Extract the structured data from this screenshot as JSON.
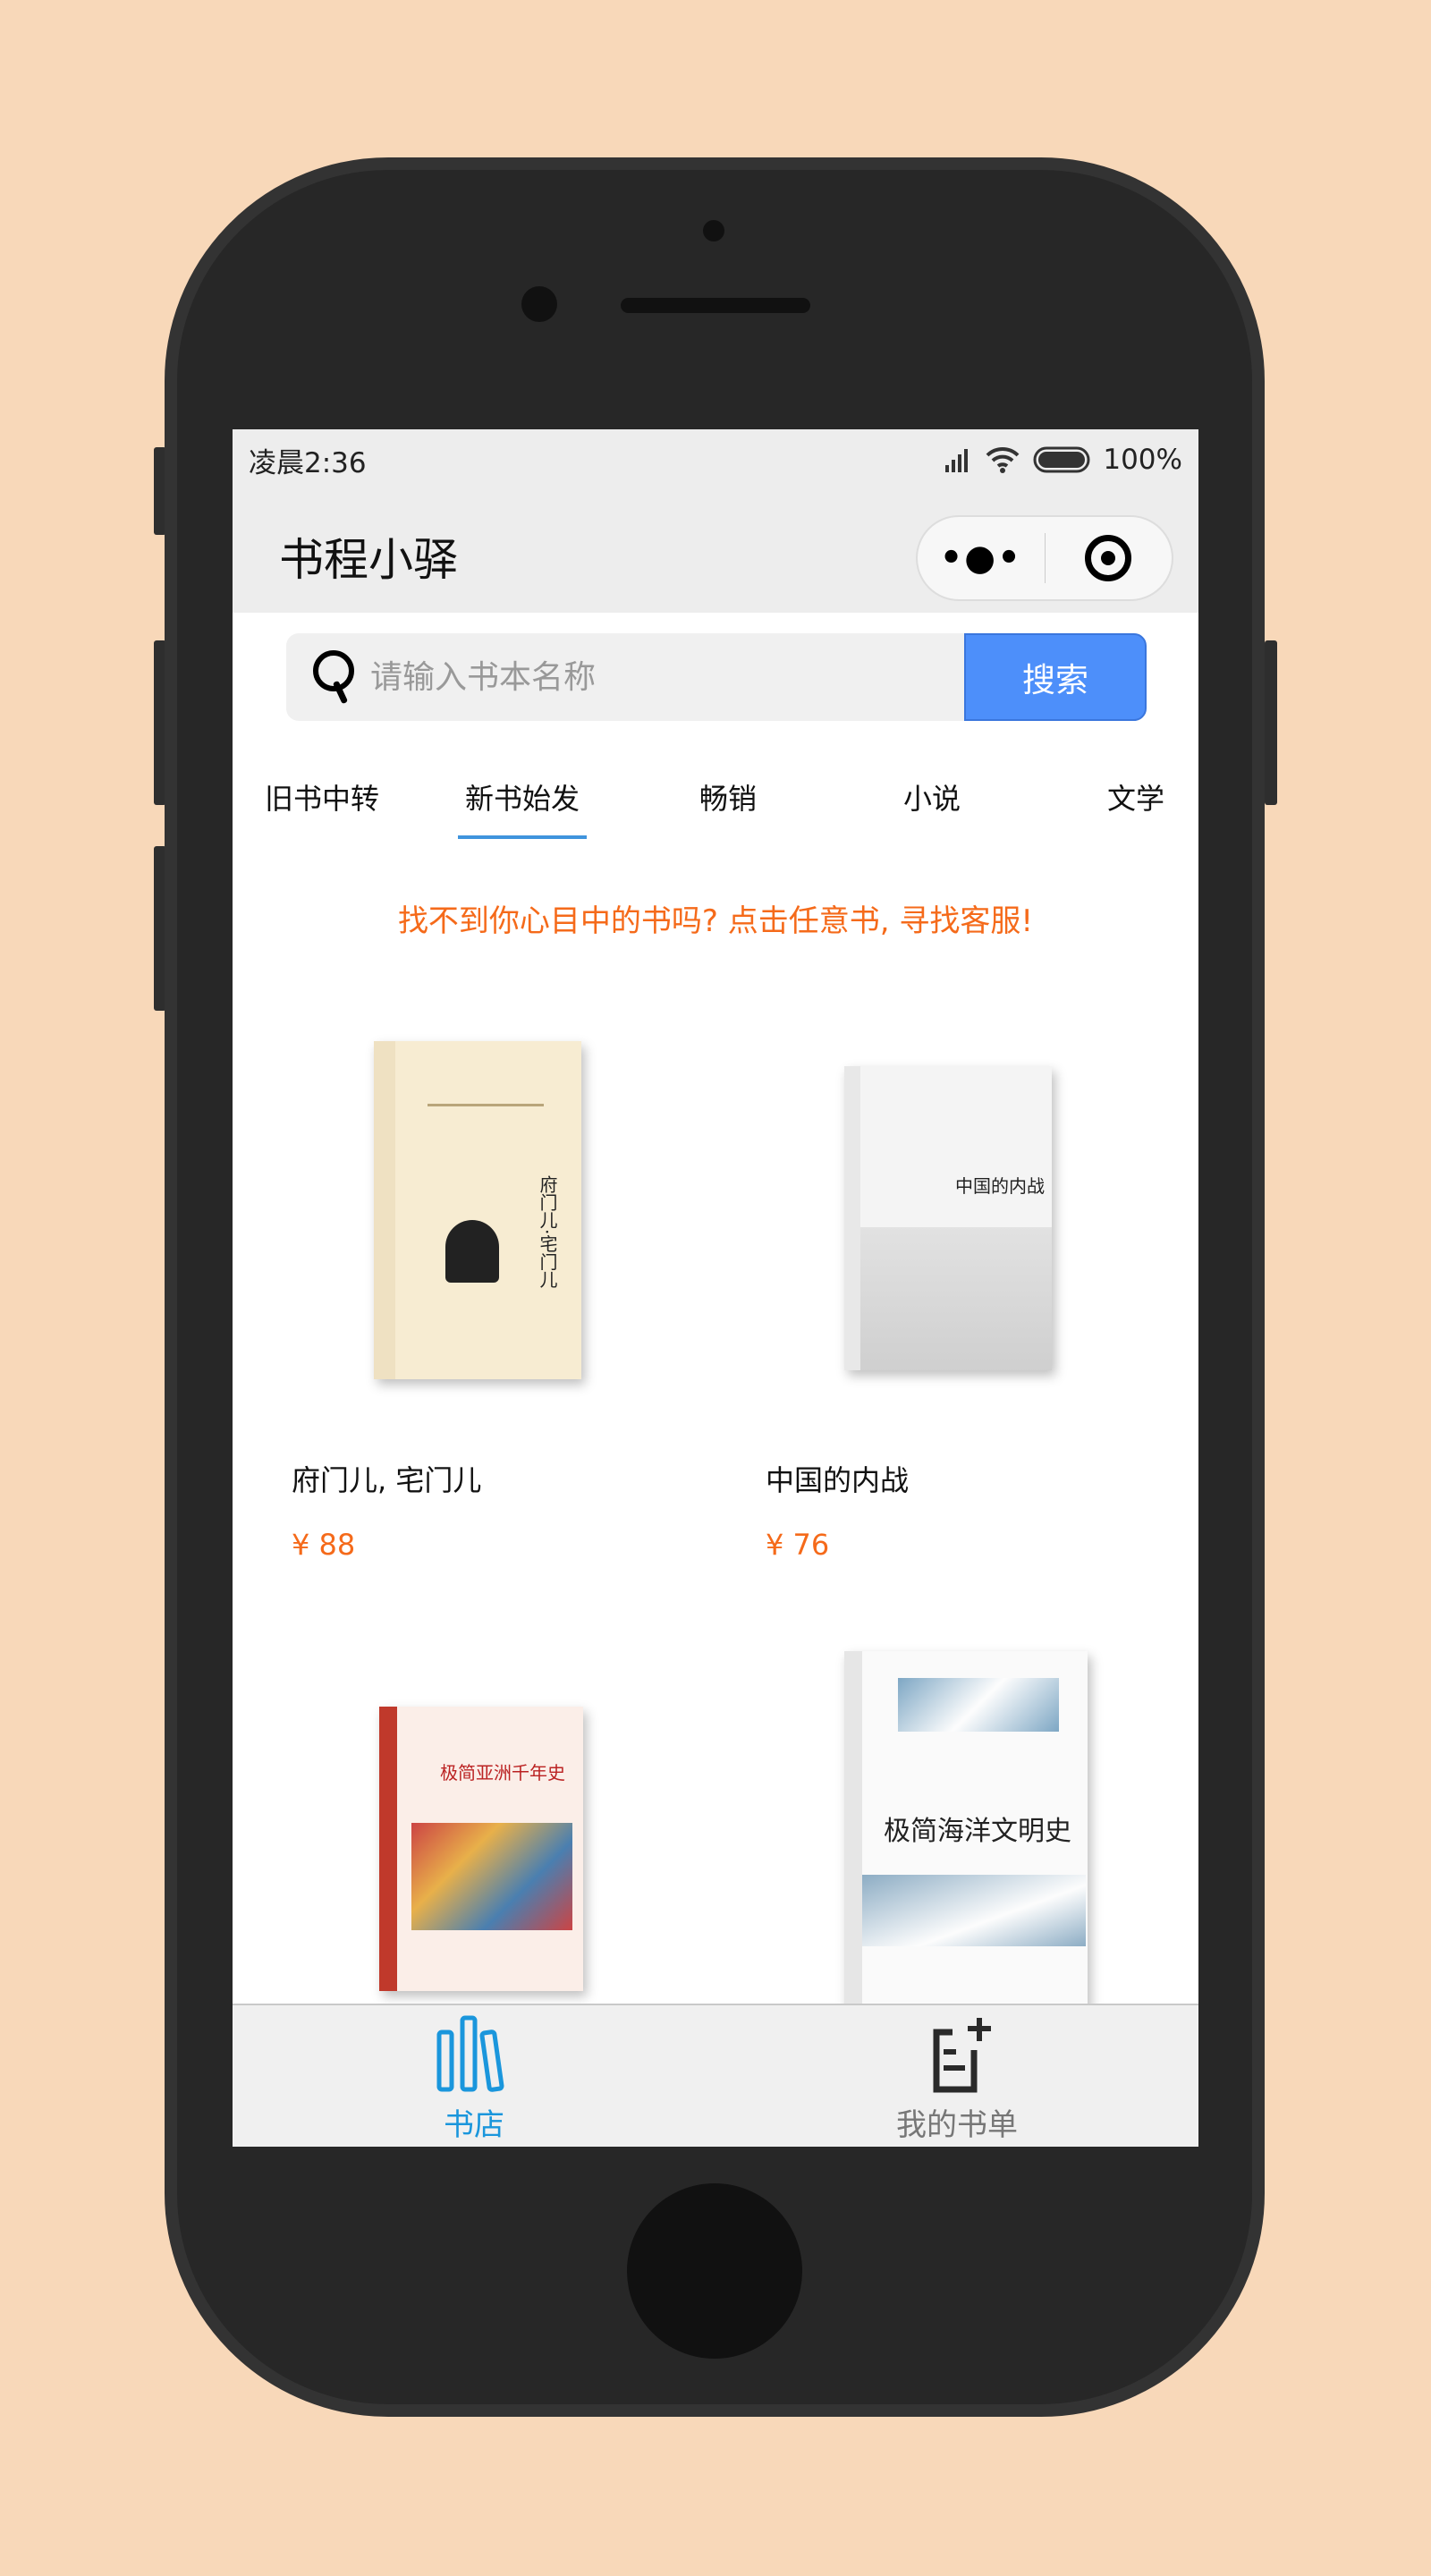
{
  "status_bar": {
    "time": "凌晨2:36",
    "battery": "100%"
  },
  "nav": {
    "title": "书程小驿",
    "more_icon": "more-dots-icon",
    "record_icon": "target-icon"
  },
  "search": {
    "placeholder": "请输入书本名称",
    "value": "",
    "button": "搜索"
  },
  "tabs": [
    {
      "label": "旧书中转"
    },
    {
      "label": "新书始发",
      "active": true
    },
    {
      "label": "畅销"
    },
    {
      "label": "小说"
    },
    {
      "label": "文学"
    }
  ],
  "notice": "找不到你心目中的书吗? 点击任意书, 寻找客服!",
  "books": [
    {
      "title": "府门儿, 宅门儿",
      "price": "¥ 88",
      "cover_text": "府门儿·宅门儿"
    },
    {
      "title": "中国的内战",
      "price": "¥ 76",
      "cover_text": "中国的内战"
    },
    {
      "title": "",
      "price": "",
      "cover_text": "极简亚洲千年史"
    },
    {
      "title": "",
      "price": "",
      "cover_text": "极简海洋文明史"
    }
  ],
  "tabbar": [
    {
      "label": "书店",
      "active": true,
      "icon": "bookshelf-icon"
    },
    {
      "label": "我的书单",
      "icon": "add-list-icon"
    }
  ],
  "colors": {
    "accent": "#1a96dc",
    "orange": "#f56a1a",
    "button": "#4d8ffa"
  }
}
